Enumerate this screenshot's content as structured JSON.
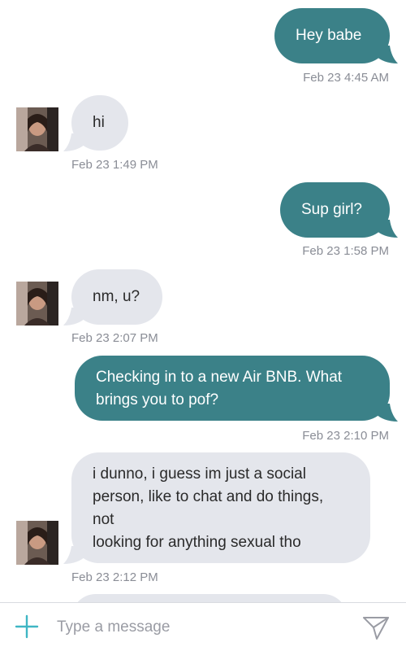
{
  "messages": [
    {
      "direction": "out",
      "text": "Hey babe",
      "time": "Feb 23 4:45 AM"
    },
    {
      "direction": "in",
      "text": "hi",
      "time": "Feb 23 1:49 PM"
    },
    {
      "direction": "out",
      "text": "Sup girl?",
      "time": "Feb 23 1:58 PM"
    },
    {
      "direction": "in",
      "text": "nm, u?",
      "time": "Feb 23 2:07 PM"
    },
    {
      "direction": "out",
      "text_lines": [
        "Checking in to a new Air BNB. What",
        "brings you to pof?"
      ],
      "time": "Feb 23 2:10 PM"
    },
    {
      "direction": "in",
      "text_lines": [
        "i dunno, i guess im just a social",
        "person, like to chat and do things,",
        "not",
        "looking for anything sexual tho"
      ],
      "time": "Feb 23 2:12 PM"
    }
  ],
  "composer": {
    "placeholder": "Type a message",
    "value": "",
    "add_icon": "plus-icon",
    "send_icon": "send-icon"
  },
  "colors": {
    "outgoing_bubble": "#3b8188",
    "incoming_bubble": "#e4e6ec",
    "timestamp": "#8a8d96",
    "accent": "#3fb6c4"
  }
}
